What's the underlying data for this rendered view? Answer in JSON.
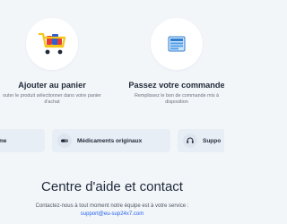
{
  "steps": [
    {
      "title": "Ajouter au panier",
      "description": "outer le produit sélectionner dans votre panier d'achat",
      "icon": "shopping-cart-icon"
    },
    {
      "title": "Passez votre commande",
      "description": "Remplissez le bon de commande mis à disposition",
      "icon": "order-form-icon"
    }
  ],
  "features": [
    {
      "label": "me"
    },
    {
      "label": "Médicaments originaux",
      "icon": "pills-icon"
    },
    {
      "label": "Suppo",
      "icon": "headset-icon"
    }
  ],
  "contact": {
    "title": "Centre d'aide et contact",
    "text": "Contactez-nous à tout moment notre équipe est à votre service :",
    "email": "support@eu-sup24x7.com",
    "link_color": "#2563eb"
  },
  "colors": {
    "background": "#f3f6f9",
    "card": "#e8eef5",
    "accent": "#2563eb",
    "cart_yellow": "#f5c518",
    "bag_blue": "#2f5fd0",
    "bag_red": "#e53935"
  }
}
